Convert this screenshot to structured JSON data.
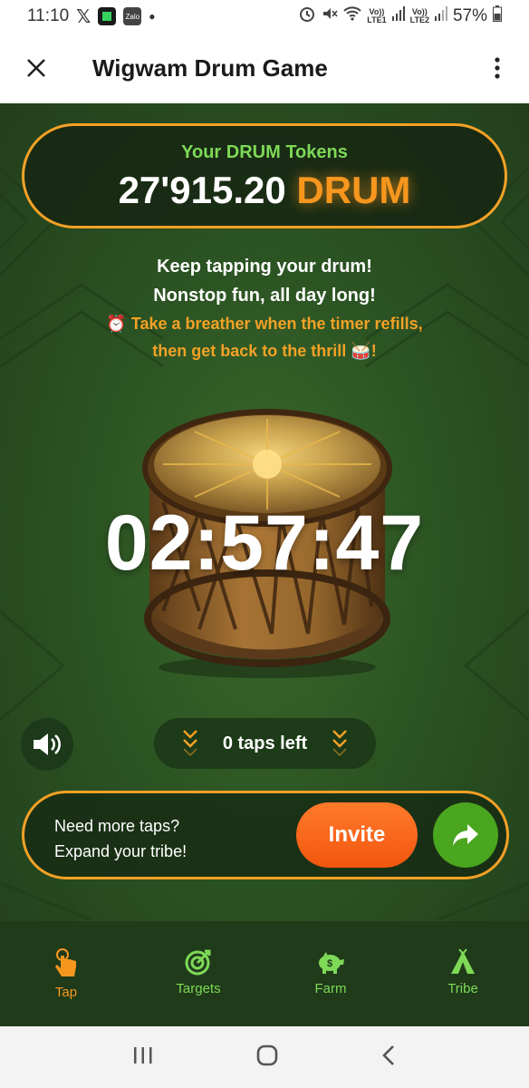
{
  "status_bar": {
    "time": "11:10",
    "sim1": "Vo))\nLTE1",
    "sim2": "Vo))\nLTE2",
    "battery": "57%",
    "zalo_label": "Zalo"
  },
  "header": {
    "title": "Wigwam Drum Game"
  },
  "tokens": {
    "label": "Your DRUM Tokens",
    "amount": "27'915.20",
    "unit": "DRUM"
  },
  "messages": {
    "line1": "Keep tapping your drum!",
    "line2": "Nonstop fun, all day long!",
    "line3": "⏰ Take a breather when the timer refills,",
    "line4": "then get back to the thrill 🥁!"
  },
  "timer": "02:57:47",
  "taps": {
    "text": "0 taps left"
  },
  "invite": {
    "line1": "Need more taps?",
    "line2": "Expand your tribe!",
    "button": "Invite"
  },
  "nav": {
    "items": [
      {
        "label": "Tap",
        "active": true
      },
      {
        "label": "Targets",
        "active": false
      },
      {
        "label": "Farm",
        "active": false
      },
      {
        "label": "Tribe",
        "active": false
      }
    ]
  },
  "colors": {
    "accent_orange": "#f3a126",
    "accent_green": "#7ed957",
    "invite_orange": "#f2560e",
    "share_green": "#4aa51f",
    "background_green": "#2c5423"
  }
}
